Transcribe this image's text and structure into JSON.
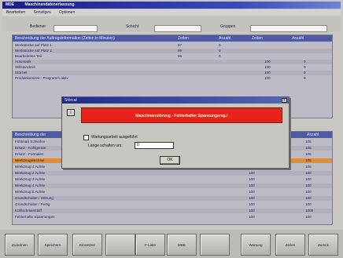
{
  "window": {
    "app": "MDE",
    "title": "Maschinendatenerfassung"
  },
  "menu": [
    "Bearbeiten",
    "Sonstiges",
    "Optionen"
  ],
  "filters": [
    {
      "label": "Bediener",
      "value": ""
    },
    {
      "label": "Schicht",
      "value": ""
    },
    {
      "label": "Gruppen",
      "value": ""
    }
  ],
  "top_table": {
    "headers": [
      "Beschreibung der Auftragsinformation (Zeiten in Minuten)",
      "Zeiten",
      "Anzahl",
      "Zeiten",
      "Anzahl"
    ],
    "rows": [
      [
        "Werkstücke auf Platz 1",
        "97",
        "0",
        "",
        ""
      ],
      [
        "Werkstücke auf Platz 2",
        "89",
        "0",
        "",
        ""
      ],
      [
        "Bearbeitetes Teil",
        "56",
        "0",
        "",
        ""
      ],
      [
        "Automatik",
        "",
        "",
        "100",
        "0"
      ],
      [
        "Stillstandzeit",
        "",
        "",
        "100",
        "0"
      ],
      [
        "Störzeit",
        "",
        "",
        "100",
        "0"
      ],
      [
        "Produktionszeit - Programm aktiv",
        "",
        "",
        "100",
        "0"
      ]
    ]
  },
  "bottom_table": {
    "headers": [
      "Beschreibung der",
      "Anzahl"
    ],
    "rows": [
      [
        "Fühlmaß Schleifen",
        "100",
        "105"
      ],
      [
        "Ersatz - Kühlgeräte",
        "100",
        "105"
      ],
      [
        "Ersatz - Formalen",
        "100",
        "105"
      ],
      [
        "Werkzeugwechsel",
        "100",
        "105"
      ],
      [
        "Werkzeug 4 Achse",
        "100",
        "106"
      ],
      [
        "Werkzeug 2 Achse",
        "100",
        "100"
      ],
      [
        "Werkzeug 3 Achse",
        "100",
        "100"
      ],
      [
        "Werkzeug 4 Achse",
        "100",
        "100"
      ],
      [
        "Werkzeug 5 Achse",
        "100",
        "100"
      ],
      [
        "Grundschalter / Störung",
        "100",
        "100"
      ],
      [
        "Grundschalter / Fertig",
        "100",
        "100"
      ],
      [
        "Kühlschmierstoff",
        "100",
        "1000"
      ],
      [
        "Fehlerhafte Spannungen",
        "100",
        "100"
      ]
    ]
  },
  "dialog": {
    "title": "Störcal",
    "close": "×",
    "icon": "info-icon",
    "alarm_text": "Maschinenstörung - Fehlerhafter Spannungsreg.!",
    "checkbox_label": "Wartungsarbeit ausgeführt",
    "log_label": "Länge schalten um:",
    "log_value": "0",
    "ok_label": "OK"
  },
  "buttons": [
    "Zuordnen",
    "Speichern",
    "Einsetzen",
    "",
    "F-Liste",
    "MDE",
    "",
    "Wartung",
    "Zeilen",
    "Zurück"
  ],
  "colors": {
    "alarm": "#e5241c",
    "header": "#4e5ba0",
    "selected_row": "#d98f3c"
  }
}
